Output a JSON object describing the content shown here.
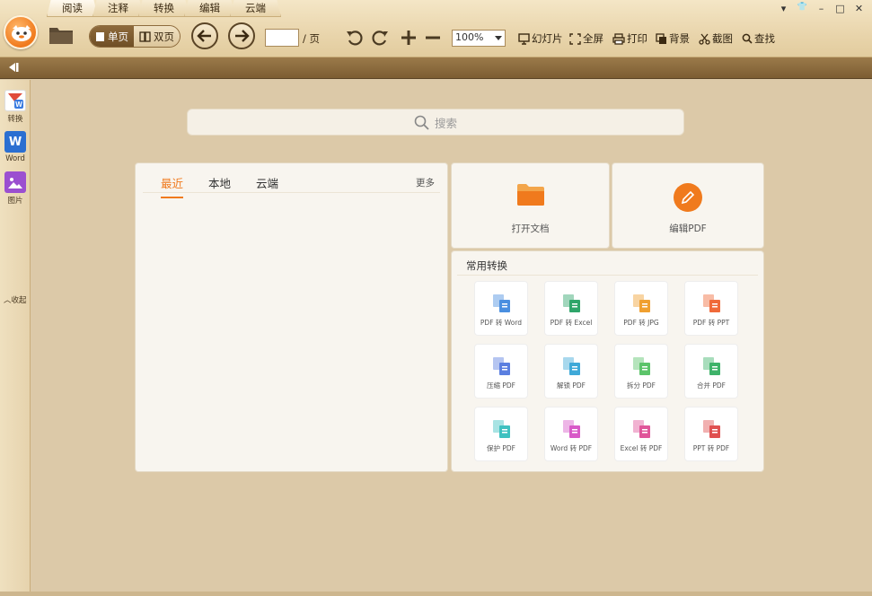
{
  "tabs": [
    {
      "label": "阅读",
      "active": true
    },
    {
      "label": "注释",
      "active": false
    },
    {
      "label": "转换",
      "active": false
    },
    {
      "label": "编辑",
      "active": false
    },
    {
      "label": "云端",
      "active": false
    }
  ],
  "window": {
    "menu": "▾",
    "skin": "👕",
    "minimize": "–",
    "maximize": "□",
    "close": "✕"
  },
  "toolbar": {
    "single_page": "单页",
    "double_page": "双页",
    "page_value": "",
    "page_label": "/ 页",
    "zoom": "100%",
    "slideshow": "幻灯片",
    "fullscreen": "全屏",
    "print": "打印",
    "background": "背景",
    "screenshot": "截图",
    "find": "查找"
  },
  "sidebar": {
    "items": [
      {
        "label": "转换",
        "icon": "convert-icon"
      },
      {
        "label": "Word",
        "icon": "word-icon"
      },
      {
        "label": "图片",
        "icon": "image-icon"
      }
    ],
    "collapse": "收起"
  },
  "search": {
    "placeholder": "搜索"
  },
  "recent": {
    "tabs": [
      {
        "label": "最近",
        "active": true
      },
      {
        "label": "本地",
        "active": false
      },
      {
        "label": "云端",
        "active": false
      }
    ],
    "more": "更多"
  },
  "actions": {
    "open": "打开文档",
    "edit": "编辑PDF"
  },
  "conversion": {
    "title": "常用转换",
    "items": [
      {
        "label": "PDF 转 Word",
        "color": "#4a8fe0"
      },
      {
        "label": "PDF 转 Excel",
        "color": "#2fa56a"
      },
      {
        "label": "PDF 转 JPG",
        "color": "#f0a030"
      },
      {
        "label": "PDF 转 PPT",
        "color": "#f06a3a"
      },
      {
        "label": "压缩 PDF",
        "color": "#5b7fe0"
      },
      {
        "label": "解锁 PDF",
        "color": "#3fa9d8"
      },
      {
        "label": "拆分 PDF",
        "color": "#5cc46a"
      },
      {
        "label": "合并 PDF",
        "color": "#3fb36a"
      },
      {
        "label": "保护 PDF",
        "color": "#3fc1c0"
      },
      {
        "label": "Word 转 PDF",
        "color": "#d85ac8"
      },
      {
        "label": "Excel 转 PDF",
        "color": "#e0559a"
      },
      {
        "label": "PPT 转 PDF",
        "color": "#e05050"
      }
    ]
  }
}
